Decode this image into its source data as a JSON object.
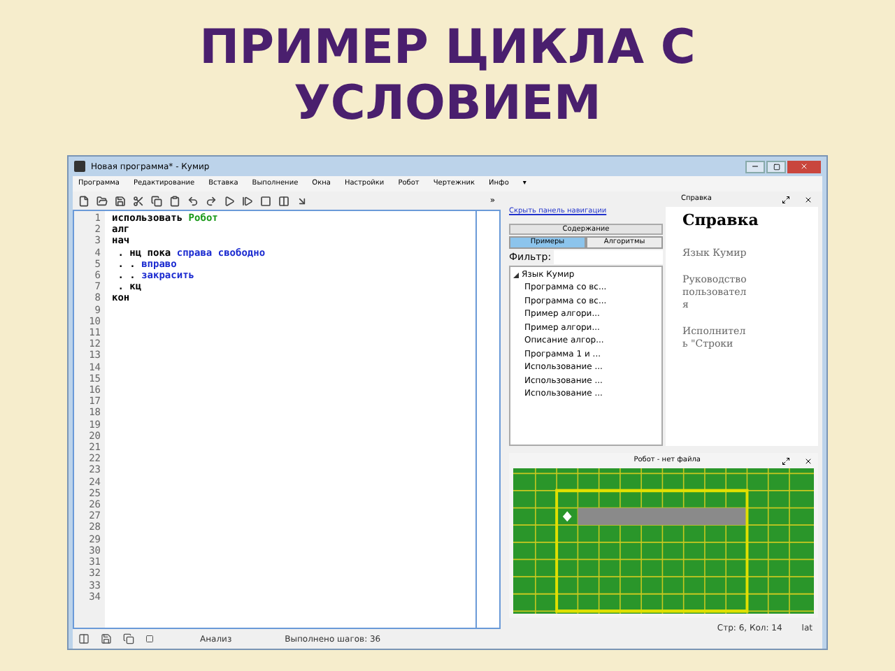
{
  "slide_title": "ПРИМЕР ЦИКЛА С УСЛОВИЕМ",
  "window": {
    "title": "Новая программа* - Кумир"
  },
  "menu": [
    "Программа",
    "Редактирование",
    "Вставка",
    "Выполнение",
    "Окна",
    "Настройки",
    "Робот",
    "Чертежник",
    "Инфо",
    "▾"
  ],
  "toolbar_overflow": "»",
  "editor": {
    "line_numbers": [
      "1",
      "2",
      "3",
      "4",
      "5",
      "6",
      "7",
      "8",
      "9",
      "10",
      "11",
      "12",
      "13",
      "14",
      "15",
      "16",
      "17",
      "18",
      "19",
      "20",
      "21",
      "22",
      "23",
      "24",
      "25",
      "26",
      "27",
      "28",
      "29",
      "30",
      "31",
      "32",
      "33",
      "34"
    ],
    "lines": [
      {
        "parts": [
          {
            "text": "использовать ",
            "kind": "keyword"
          },
          {
            "text": "Робот",
            "kind": "module"
          }
        ]
      },
      {
        "parts": [
          {
            "text": "алг",
            "kind": "keyword"
          }
        ]
      },
      {
        "parts": [
          {
            "text": "нач",
            "kind": "keyword"
          }
        ]
      },
      {
        "parts": [
          {
            "text": " . нц пока ",
            "kind": "keyword"
          },
          {
            "text": "справа свободно",
            "kind": "command"
          }
        ]
      },
      {
        "parts": [
          {
            "text": " . . ",
            "kind": "keyword"
          },
          {
            "text": "вправо",
            "kind": "command"
          }
        ]
      },
      {
        "parts": [
          {
            "text": " . . ",
            "kind": "keyword"
          },
          {
            "text": "закрасить",
            "kind": "command"
          }
        ]
      },
      {
        "parts": [
          {
            "text": " . кц",
            "kind": "keyword"
          }
        ]
      },
      {
        "parts": [
          {
            "text": "кон",
            "kind": "keyword"
          }
        ]
      }
    ]
  },
  "help": {
    "title": "Справка",
    "hide_link": "Скрыть панель навигации",
    "contents_button": "Содержание",
    "tabs": [
      {
        "label": "Примеры",
        "selected": true
      },
      {
        "label": "Алгоритмы",
        "selected": false
      }
    ],
    "filter_label": "Фильтр:",
    "tree": [
      {
        "label": "Язык Кумир",
        "expanded": true,
        "children": [
          {
            "label": "Программа со вс..."
          },
          {
            "label": "Программа со вс..."
          },
          {
            "label": "Пример алгори..."
          },
          {
            "label": "Пример алгори..."
          },
          {
            "label": "Описание алгор..."
          },
          {
            "label": "Программа 1 и ..."
          },
          {
            "label": "Использование ..."
          },
          {
            "label": "Использование ..."
          },
          {
            "label": "Использование ..."
          }
        ]
      }
    ],
    "page_heading": "Справка",
    "page_links": [
      "Язык Кумир",
      "Руководство пользователя",
      "Исполнитель \"Строки"
    ]
  },
  "robot": {
    "title": "Робот - нет файла"
  },
  "status_bar": {
    "mode": "Анализ",
    "steps": "Выполнено шагов: 36",
    "position": "Стр: 6, Кол: 14",
    "layout": "lat"
  }
}
